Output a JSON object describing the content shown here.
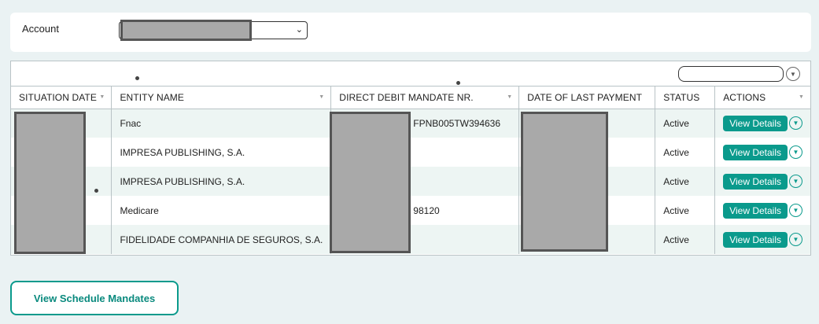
{
  "account": {
    "label": "Account",
    "select_chevron": "⌄"
  },
  "table": {
    "columns": [
      {
        "label": "SITUATION DATE"
      },
      {
        "label": "ENTITY NAME"
      },
      {
        "label": "DIRECT DEBIT MANDATE NR."
      },
      {
        "label": "DATE OF LAST PAYMENT"
      },
      {
        "label": "STATUS"
      },
      {
        "label": "ACTIONS"
      }
    ],
    "rows": [
      {
        "entity": "Fnac",
        "mandate": "FPNB005TW394636",
        "status": "Active",
        "action": "View Details"
      },
      {
        "entity": "IMPRESA PUBLISHING, S.A.",
        "mandate": "",
        "status": "Active",
        "action": "View Details"
      },
      {
        "entity": "IMPRESA PUBLISHING, S.A.",
        "mandate": "",
        "status": "Active",
        "action": "View Details"
      },
      {
        "entity": "Medicare",
        "mandate": "98120",
        "status": "Active",
        "action": "View Details"
      },
      {
        "entity": "FIDELIDADE COMPANHIA DE SEGUROS, S.A.",
        "mandate": "",
        "status": "Active",
        "action": "View Details"
      }
    ]
  },
  "footer": {
    "schedule_button": "View Schedule Mandates"
  },
  "colors": {
    "accent": "#0a9a8c",
    "background": "#eaf2f3",
    "row_alt": "#edf5f3",
    "redaction": "#a9a9a9"
  },
  "icons": {
    "sort": "sort-icon",
    "dropdown": "chevron-down-icon",
    "more": "more-options-icon"
  }
}
